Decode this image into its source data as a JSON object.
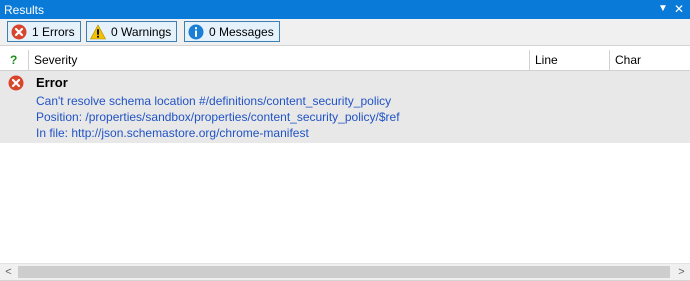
{
  "panel": {
    "title": "Results",
    "dropdown_glyph": "▼",
    "close_glyph": "✕"
  },
  "toolbar": {
    "errors_label": "1 Errors",
    "warnings_label": "0 Warnings",
    "messages_label": "0 Messages"
  },
  "grid": {
    "headers": {
      "status": "?",
      "severity": "Severity",
      "line": "Line",
      "char": "Char"
    },
    "rows": [
      {
        "severity": "Error",
        "message": "Can't resolve schema location #/definitions/content_security_policy",
        "position": "Position: /properties/sandbox/properties/content_security_policy/$ref",
        "file": "In file: http://json.schemastore.org/chrome-manifest"
      }
    ]
  },
  "scrollbar": {
    "left_glyph": "<",
    "right_glyph": ">"
  },
  "colors": {
    "titlebar": "#0a7ad8",
    "error": "#d9442c",
    "warning": "#f2c100",
    "info": "#1a7ed6",
    "link_text": "#2153c6",
    "status_header": "#1e8c1e"
  },
  "icons": [
    "error-icon",
    "warning-icon",
    "info-icon",
    "help-icon"
  ]
}
